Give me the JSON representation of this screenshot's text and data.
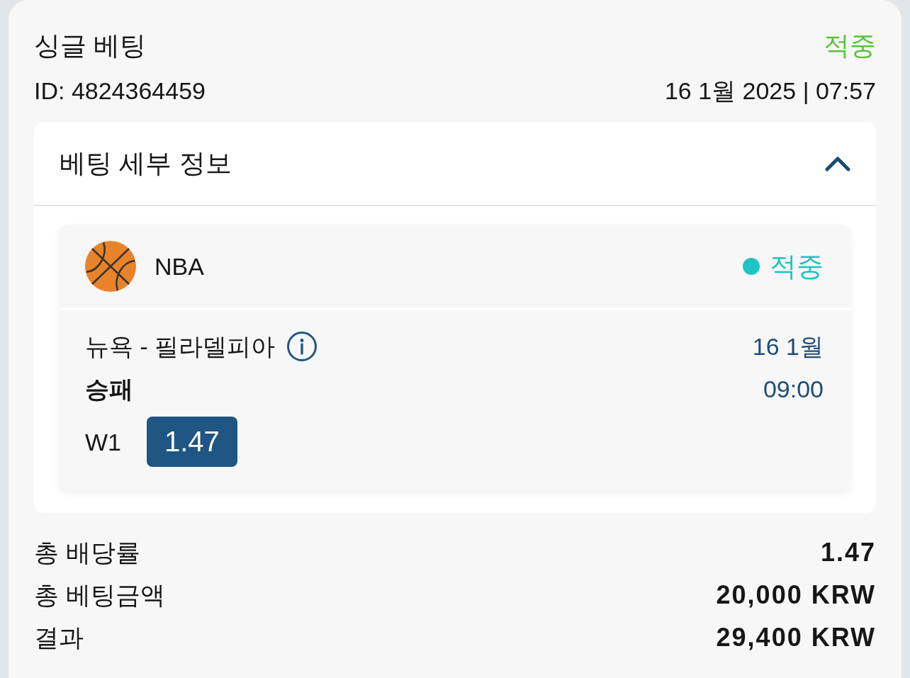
{
  "bet": {
    "title": "싱글 베팅",
    "status": "적중",
    "id": "ID: 4824364459",
    "datetime": "16 1월 2025 | 07:57"
  },
  "details": {
    "title": "베팅 세부 정보",
    "expanded": true,
    "event": {
      "league": "NBA",
      "status": "적중",
      "color": "#1dc4c4",
      "teams": "뉴욕 - 필라델피아",
      "market": "승패",
      "date": "16 1월",
      "time": "09:00",
      "pick": "W1",
      "odds": "1.47"
    }
  },
  "summary": [
    {
      "label": "총 배당률",
      "value": "1.47"
    },
    {
      "label": "총 베팅금액",
      "value": "20,000 KRW"
    },
    {
      "label": "결과",
      "value": "29,400 KRW"
    }
  ]
}
